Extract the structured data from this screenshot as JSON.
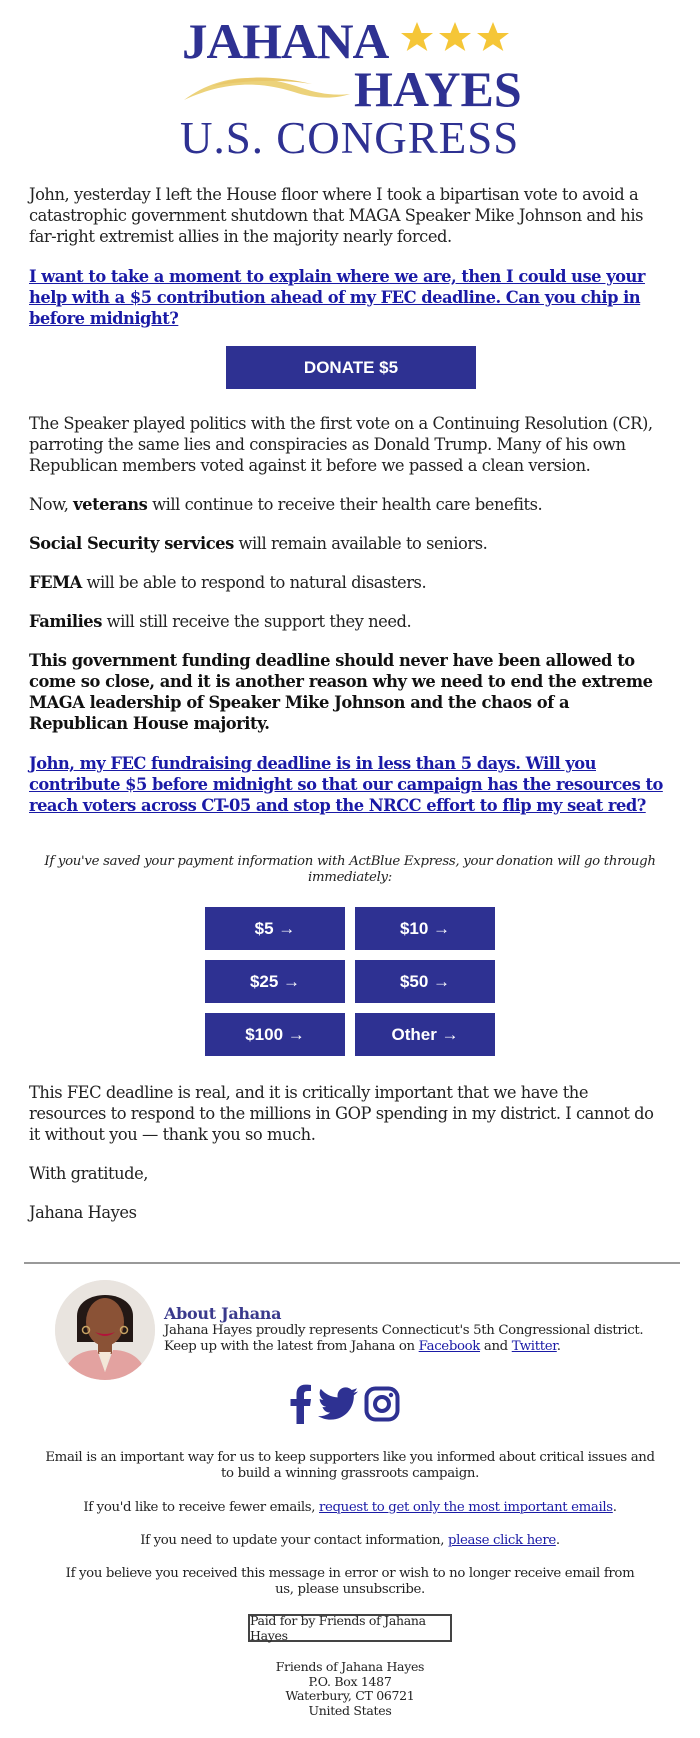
{
  "logo": {
    "line1": "JAHANA",
    "line2": "HAYES",
    "line3": "U.S. CONGRESS",
    "stars": 3,
    "brand_color": "#2e3192",
    "star_color": "#f5c637"
  },
  "email": {
    "intro": "John, yesterday I left the House floor where I took a bipartisan vote to avoid a catastrophic government shutdown that MAGA Speaker Mike Johnson and his far-right extremist allies in the majority nearly forced.",
    "cta_link_1": "I want to take a moment to explain where we are, then I could use your help with a $5 contribution ahead of my FEC deadline. Can you chip in before midnight?",
    "donate_button": "DONATE $5",
    "cr_paragraph": "The Speaker played politics with the first vote on a Continuing Resolution (CR), parroting the same lies and conspiracies as Donald Trump. Many of his own Republican members voted against it before we passed a clean version.",
    "veterans": {
      "prefix": "Now, ",
      "bold": "veterans",
      "rest": " will continue to receive their health care benefits."
    },
    "social_security": {
      "bold": "Social Security services",
      "rest": " will remain available to seniors."
    },
    "fema": {
      "bold": "FEMA",
      "rest": " will be able to respond to natural disasters."
    },
    "families": {
      "bold": "Families",
      "rest": " will still receive the support they need."
    },
    "bold_paragraph": "This government funding deadline should never have been allowed to come so close, and it is another reason why we need to end the extreme MAGA leadership of Speaker Mike Johnson and the chaos of a Republican House majority.",
    "cta_link_2": "John, my FEC fundraising deadline is in less than 5 days. Will you contribute $5 before midnight so that our campaign has the resources to reach voters across CT-05 and stop the NRCC effort to flip my seat red?",
    "actblue_note": "If you've saved your payment information with ActBlue Express, your donation will go through immediately:",
    "amount_buttons": [
      "$5 →",
      "$10 →",
      "$25 →",
      "$50 →",
      "$100 →",
      "Other →"
    ],
    "closing_paragraph": "This FEC deadline is real, and it is critically important that we have the resources to respond to the millions in GOP spending in my district. I cannot do it without you — thank you so much.",
    "signoff": "With gratitude,",
    "signature": "Jahana Hayes"
  },
  "footer": {
    "about_title": "About Jahana",
    "about_line1": "Jahana Hayes proudly represents Connecticut's 5th Congressional district.",
    "about_line2_prefix": "Keep up with the latest from Jahana on ",
    "facebook_link": "Facebook",
    "about_and": " and ",
    "twitter_link": "Twitter",
    "about_end": ".",
    "social_icons": [
      "facebook-icon",
      "twitter-icon",
      "instagram-icon"
    ],
    "email_importance": "Email is an important way for us to keep supporters like you informed about critical issues and to build a winning grassroots campaign.",
    "fewer_emails_prefix": "If you'd like to receive fewer emails, ",
    "fewer_emails_link": "request to get only the most important emails",
    "fewer_emails_end": ".",
    "update_prefix": "If you need to update your contact information, ",
    "update_link": "please click here",
    "update_end": ".",
    "unsubscribe_text": "If you believe you received this message in error or wish to no longer receive email from us, please unsubscribe.",
    "paid_for": "Paid for by Friends of Jahana Hayes",
    "address": [
      "Friends of Jahana Hayes",
      "P.O. Box 1487",
      "Waterbury, CT 06721",
      "United States"
    ]
  }
}
